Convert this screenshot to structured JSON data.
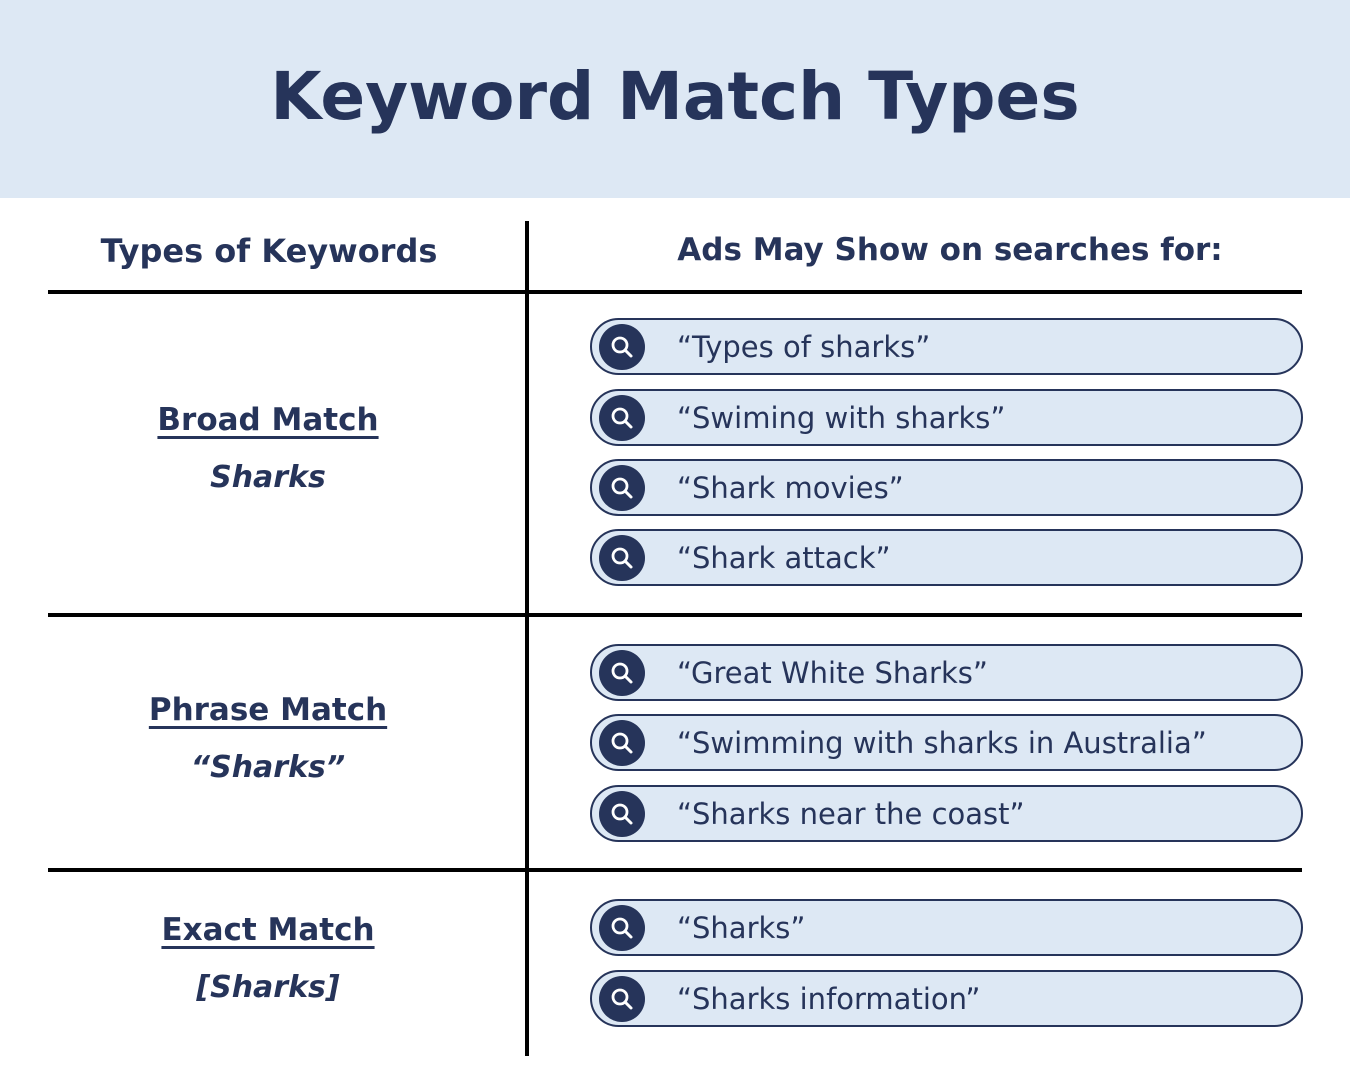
{
  "title": "Keyword Match Types",
  "columns": {
    "left_header": "Types of Keywords",
    "right_header": "Ads May Show on searches for:"
  },
  "colors": {
    "primary": "#26345a",
    "banner_bg": "#dde8f4",
    "pill_bg": "#dde8f4",
    "divider": "#000000"
  },
  "match_types": [
    {
      "name": "Broad Match",
      "example": "Sharks",
      "searches": [
        "“Types of sharks”",
        "“Swiming with sharks”",
        "“Shark movies”",
        "“Shark attack”"
      ]
    },
    {
      "name": "Phrase Match",
      "example": "“Sharks”",
      "searches": [
        "“Great White Sharks”",
        "“Swimming with sharks in Australia”",
        "“Sharks near the coast”"
      ]
    },
    {
      "name": "Exact Match",
      "example": "[Sharks]",
      "searches": [
        "“Sharks”",
        "“Sharks information”"
      ]
    }
  ],
  "icons": {
    "search": "search-icon"
  }
}
